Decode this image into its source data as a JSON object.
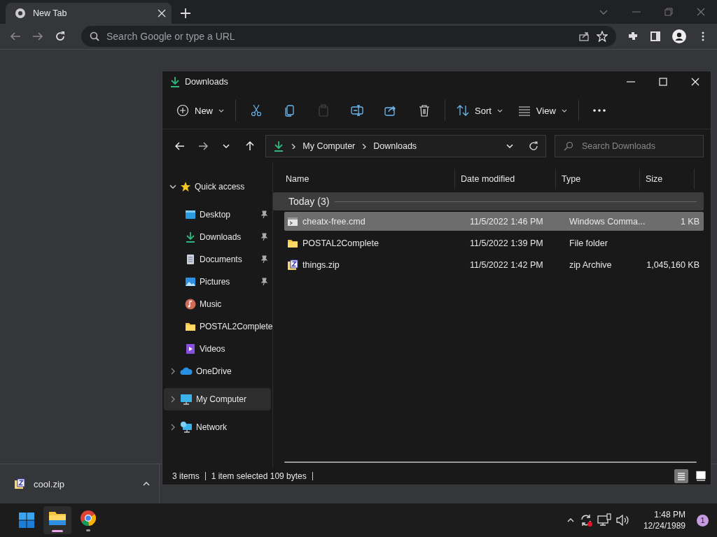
{
  "browser": {
    "tabs": [
      {
        "title": "New Tab",
        "selected": true
      }
    ],
    "omnibox": {
      "placeholder": "Search Google or type a URL"
    },
    "download_bar": {
      "items": [
        {
          "name": "cool.zip"
        }
      ]
    }
  },
  "explorer": {
    "title": "Downloads",
    "toolbar": [
      {
        "kind": "new",
        "label": "New",
        "disabled": false
      },
      {
        "kind": "cut",
        "disabled": false
      },
      {
        "kind": "copy",
        "disabled": false
      },
      {
        "kind": "paste",
        "disabled": true
      },
      {
        "kind": "rename",
        "disabled": false
      },
      {
        "kind": "share",
        "disabled": false
      },
      {
        "kind": "delete",
        "disabled": false
      },
      {
        "kind": "sort",
        "label": "Sort",
        "disabled": false
      },
      {
        "kind": "view",
        "label": "View",
        "disabled": false
      },
      {
        "kind": "more",
        "disabled": false
      }
    ],
    "address": {
      "path": [
        "My Computer",
        "Downloads"
      ]
    },
    "search": {
      "placeholder": "Search Downloads"
    },
    "sidebar": [
      {
        "kind": "star",
        "label": "Quick access",
        "expanded": true,
        "selected": false,
        "children": [
          {
            "kind": "desktop",
            "label": "Desktop",
            "pinned": true,
            "selected": false
          },
          {
            "kind": "download",
            "label": "Downloads",
            "pinned": true,
            "selected": false
          },
          {
            "kind": "document",
            "label": "Documents",
            "pinned": true,
            "selected": false
          },
          {
            "kind": "pictures",
            "label": "Pictures",
            "pinned": true,
            "selected": false
          },
          {
            "kind": "music",
            "label": "Music",
            "pinned": false,
            "selected": false
          },
          {
            "kind": "folder",
            "label": "POSTAL2Complete",
            "pinned": false,
            "selected": false
          },
          {
            "kind": "videos",
            "label": "Videos",
            "pinned": false,
            "selected": false
          }
        ]
      },
      {
        "kind": "cloud",
        "label": "OneDrive",
        "expanded": false,
        "selected": false
      },
      {
        "kind": "computer",
        "label": "My Computer",
        "expanded": false,
        "selected": true
      },
      {
        "kind": "network",
        "label": "Network",
        "expanded": false,
        "selected": false
      }
    ],
    "columns": [
      "Name",
      "Date modified",
      "Type",
      "Size"
    ],
    "groups": [
      {
        "label": "Today (3)",
        "rows": [
          {
            "kind": "cmd",
            "name": "cheatx-free.cmd",
            "date": "11/5/2022 1:46 PM",
            "type": "Windows Comma...",
            "size": "1 KB",
            "selected": true
          },
          {
            "kind": "folder",
            "name": "POSTAL2Complete",
            "date": "11/5/2022 1:39 PM",
            "type": "File folder",
            "size": "",
            "selected": false
          },
          {
            "kind": "zip",
            "name": "things.zip",
            "date": "11/5/2022 1:42 PM",
            "type": "zip Archive",
            "size": "1,045,160 KB",
            "selected": false
          }
        ]
      }
    ],
    "status_bar": {
      "items": "3 items",
      "selection": "1 item selected  109 bytes"
    },
    "view_modes": [
      {
        "kind": "details",
        "selected": true
      },
      {
        "kind": "tiles",
        "selected": false
      }
    ]
  },
  "taskbar": {
    "apps": [
      {
        "kind": "start",
        "active": false
      },
      {
        "kind": "explorer",
        "active": true
      },
      {
        "kind": "chrome",
        "active": false
      }
    ],
    "clock": {
      "time": "1:48 PM",
      "date": "12/24/1989"
    },
    "notification_count": "1"
  }
}
